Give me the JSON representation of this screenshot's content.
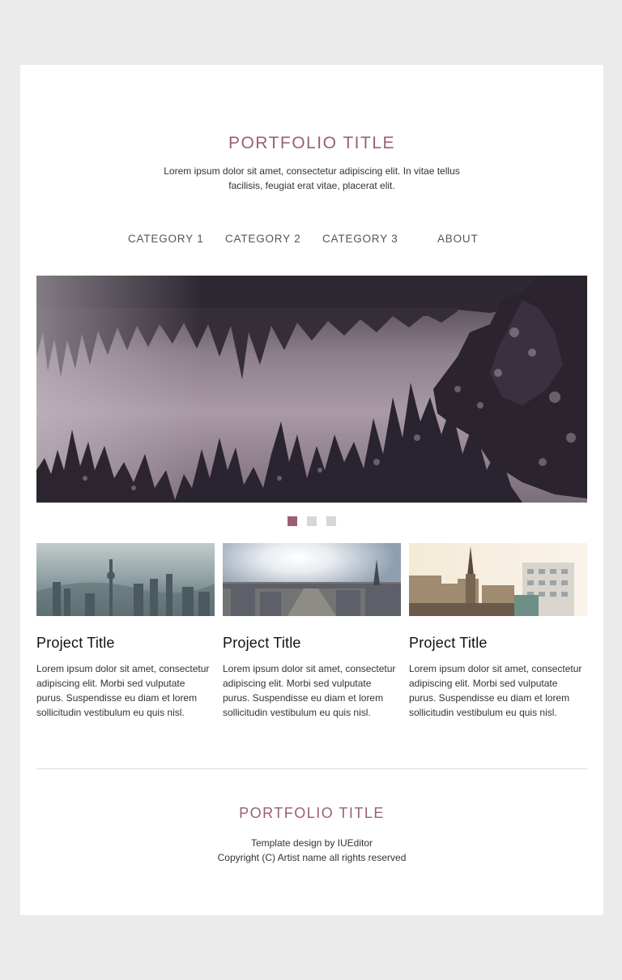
{
  "header": {
    "title": "PORTFOLIO TITLE",
    "tagline_line1": "Lorem ipsum dolor sit amet, consectetur adipiscing elit. In vitae tellus",
    "tagline_line2": "facilisis, feugiat erat vitae, placerat elit."
  },
  "nav": {
    "items": [
      {
        "label": "CATEGORY 1"
      },
      {
        "label": "CATEGORY 2"
      },
      {
        "label": "CATEGORY 3"
      },
      {
        "label": "ABOUT"
      }
    ]
  },
  "slider": {
    "slide_count": 3,
    "active_index": 0
  },
  "projects": [
    {
      "title": "Project Title",
      "text": "Lorem ipsum dolor sit amet, consectetur adipiscing elit. Morbi sed vulputate purus. Suspendisse eu diam et lorem sollicitudin vestibulum eu quis nisl."
    },
    {
      "title": "Project Title",
      "text": "Lorem ipsum dolor sit amet, consectetur adipiscing elit. Morbi sed vulputate purus. Suspendisse eu diam et lorem sollicitudin vestibulum eu quis nisl."
    },
    {
      "title": "Project Title",
      "text": "Lorem ipsum dolor sit amet, consectetur adipiscing elit. Morbi sed vulputate purus. Suspendisse eu diam et lorem sollicitudin vestibulum eu quis nisl."
    }
  ],
  "footer": {
    "title": "PORTFOLIO TITLE",
    "credit": "Template design by IUEditor",
    "copyright": "Copyright (C) Artist name all rights reserved"
  },
  "colors": {
    "accent": "#9a5f74",
    "background": "#ebebeb",
    "card": "#ffffff",
    "dot_inactive": "#d7d7d7"
  }
}
